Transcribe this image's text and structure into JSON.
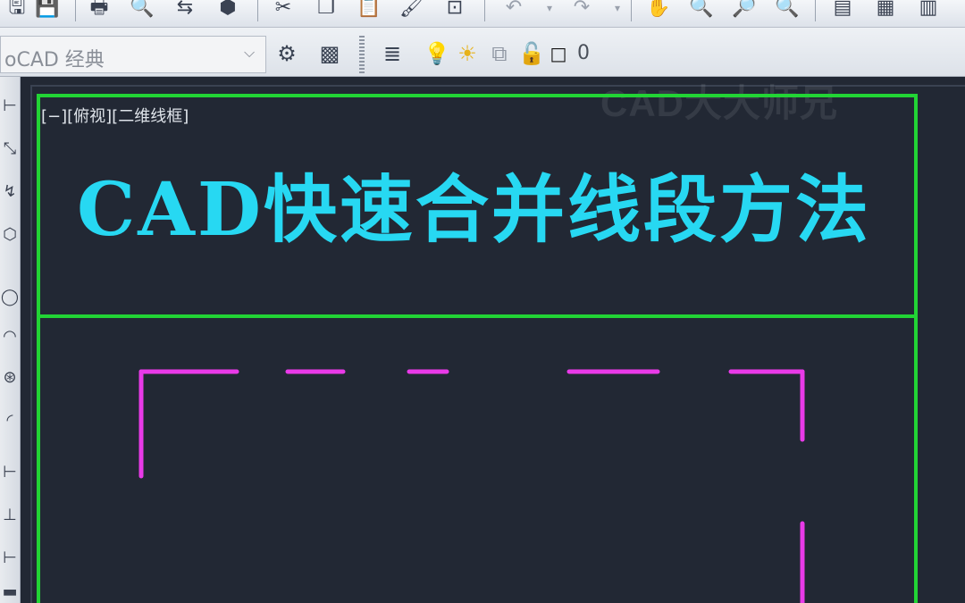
{
  "toolbar": {
    "icons": [
      "save-icon",
      "print-icon",
      "preview-icon",
      "publish-icon",
      "3d-print-icon",
      "cut-icon",
      "copy-icon",
      "paste-icon",
      "match-properties-icon",
      "block-editor-icon",
      "undo-icon",
      "redo-icon",
      "pan-icon",
      "zoom-realtime-icon",
      "zoom-window-icon",
      "zoom-previous-icon",
      "properties-icon",
      "design-center-icon",
      "tool-palettes-icon"
    ]
  },
  "workspace": {
    "name": "oCAD 经典"
  },
  "layer": {
    "name": "0"
  },
  "viewport": {
    "label": "[−][俯视][二维线框]"
  },
  "watermark": "CAD大大师兄",
  "drawing": {
    "title": "CAD快速合并线段方法"
  },
  "colors": {
    "frame": "#22d435",
    "title": "#27d8f2",
    "dashed_lines": "#e93ae8",
    "background": "#222834"
  }
}
